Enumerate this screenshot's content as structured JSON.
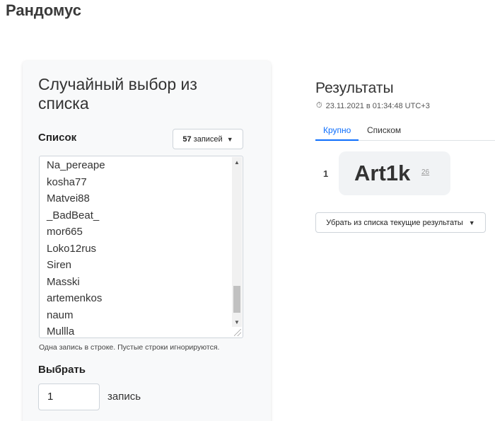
{
  "brand": "Рандомус",
  "panel": {
    "title": "Случайный выбор из списка",
    "list_label": "Список",
    "count_value": "57",
    "count_suffix": "записей",
    "items": [
      "Na_pereape",
      "kosha77",
      "Matvei88",
      "_BadBeat_",
      "mor665",
      "Loko12rus",
      "Siren",
      "Masski",
      "artemenkos",
      "naum",
      "Mullla"
    ],
    "hint": "Одна запись в строке. Пустые строки игнорируются.",
    "choose_label": "Выбрать",
    "choose_value": "1",
    "choose_unit": "запись"
  },
  "results": {
    "title": "Результаты",
    "timestamp": "23.11.2021 в 01:34:48 UTC+3",
    "tabs": [
      "Крупно",
      "Списком"
    ],
    "active_tab": "Крупно",
    "rank": "1",
    "winner": "Art1k",
    "winner_index": "26",
    "remove_button": "Убрать из списка текущие результаты"
  },
  "icons": {
    "timestamp": "stopwatch-icon",
    "dropdown": "chevron-down-icon"
  },
  "colors": {
    "accent": "#0d6efd",
    "card_bg": "#f8f9fa",
    "winner_bg": "#f1f3f5"
  }
}
